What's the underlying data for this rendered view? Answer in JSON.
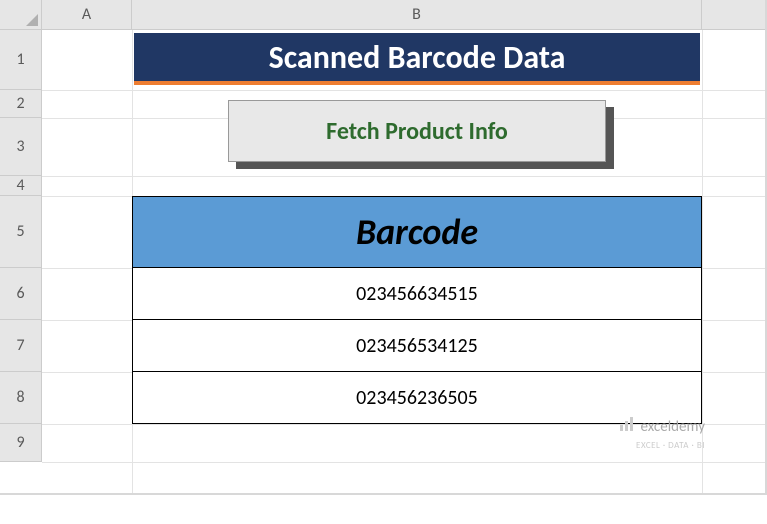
{
  "columns": {
    "a": "A",
    "b": "B"
  },
  "rows": {
    "r1": "1",
    "r2": "2",
    "r3": "3",
    "r4": "4",
    "r5": "5",
    "r6": "6",
    "r7": "7",
    "r8": "8",
    "r9": "9"
  },
  "title": "Scanned Barcode Data",
  "button_label": "Fetch Product Info",
  "table": {
    "header": "Barcode",
    "rows": [
      "023456634515",
      "023456534125",
      "023456236505"
    ]
  },
  "watermark": {
    "brand": "exceldemy",
    "tagline": "EXCEL · DATA · BI"
  }
}
